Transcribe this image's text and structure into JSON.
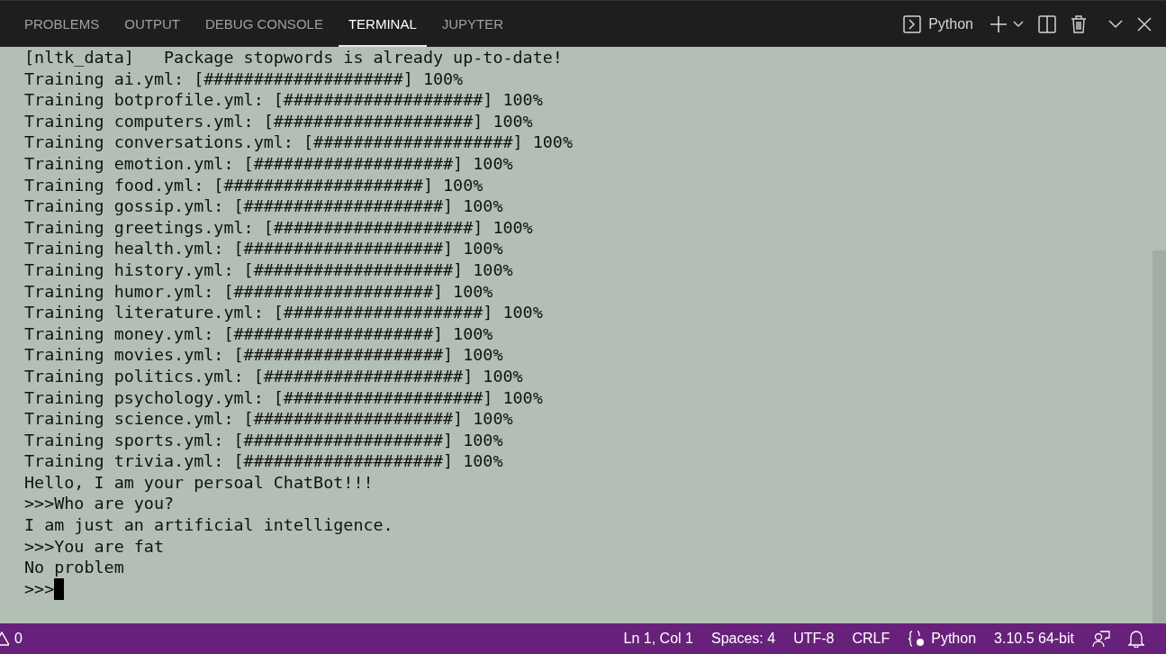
{
  "panel_tabs": [
    {
      "label": "PROBLEMS",
      "selected": false
    },
    {
      "label": "OUTPUT",
      "selected": false
    },
    {
      "label": "DEBUG CONSOLE",
      "selected": false
    },
    {
      "label": "TERMINAL",
      "selected": true
    },
    {
      "label": "JUPYTER",
      "selected": false
    }
  ],
  "terminal_profile": "Python",
  "terminal_lines": [
    "[nltk_data]   Package stopwords is already up-to-date!",
    "Training ai.yml: [####################] 100%",
    "Training botprofile.yml: [####################] 100%",
    "Training computers.yml: [####################] 100%",
    "Training conversations.yml: [####################] 100%",
    "Training emotion.yml: [####################] 100%",
    "Training food.yml: [####################] 100%",
    "Training gossip.yml: [####################] 100%",
    "Training greetings.yml: [####################] 100%",
    "Training health.yml: [####################] 100%",
    "Training history.yml: [####################] 100%",
    "Training humor.yml: [####################] 100%",
    "Training literature.yml: [####################] 100%",
    "Training money.yml: [####################] 100%",
    "Training movies.yml: [####################] 100%",
    "Training politics.yml: [####################] 100%",
    "Training psychology.yml: [####################] 100%",
    "Training science.yml: [####################] 100%",
    "Training sports.yml: [####################] 100%",
    "Training trivia.yml: [####################] 100%",
    "Hello, I am your persoal ChatBot!!!",
    ">>>Who are you?",
    "I am just an artificial intelligence.",
    ">>>You are fat",
    "No problem"
  ],
  "prompt": ">>>",
  "status_bar": {
    "warnings": "0",
    "items": [
      "Ln 1, Col 1",
      "Spaces: 4",
      "UTF-8",
      "CRLF"
    ],
    "language": "Python",
    "interpreter": "3.10.5 64-bit"
  }
}
